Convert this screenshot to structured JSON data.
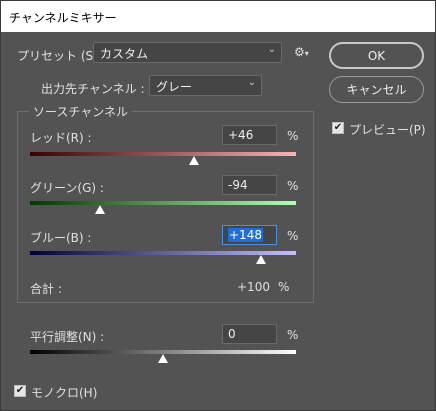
{
  "window": {
    "title": "チャンネルミキサー",
    "close_glyph": "✕"
  },
  "preset": {
    "label": "プリセット (S) :",
    "value": "カスタム"
  },
  "output_channel": {
    "label": "出力先チャンネル :",
    "value": "グレー"
  },
  "source_channels": {
    "title": "ソースチャンネル",
    "channels": [
      {
        "label": "レッド(R) :",
        "value": "+46",
        "percent": "%",
        "gradient_start": "#3a0000",
        "gradient_end": "#ffb0b0"
      },
      {
        "label": "グリーン(G) :",
        "value": "-94",
        "percent": "%",
        "gradient_start": "#003a00",
        "gradient_end": "#b0ffb0"
      },
      {
        "label": "ブルー(B) :",
        "value": "+148",
        "percent": "%",
        "gradient_start": "#00003a",
        "gradient_end": "#c0c0ff"
      }
    ],
    "total_label": "合計 :",
    "total_value": "+100",
    "total_percent": "%"
  },
  "constant": {
    "label": "平行調整(N) :",
    "value": "0",
    "percent": "%"
  },
  "monochrome": {
    "label": "モノクロ(H)",
    "checked": true
  },
  "buttons": {
    "ok": "OK",
    "cancel": "キャンセル"
  },
  "preview": {
    "label": "プレビュー(P)",
    "checked": true
  },
  "icons": {
    "gear": "⚙",
    "chevron": "⌄",
    "check": "✔"
  },
  "slider_levels": {
    "red": 0.615,
    "green": 0.265,
    "blue": 0.87,
    "constant": 0.5
  },
  "colors": {
    "ok_border": "#c8c8c8",
    "field_focus": "#4a8fe0",
    "selection": "#1e6fd9"
  }
}
